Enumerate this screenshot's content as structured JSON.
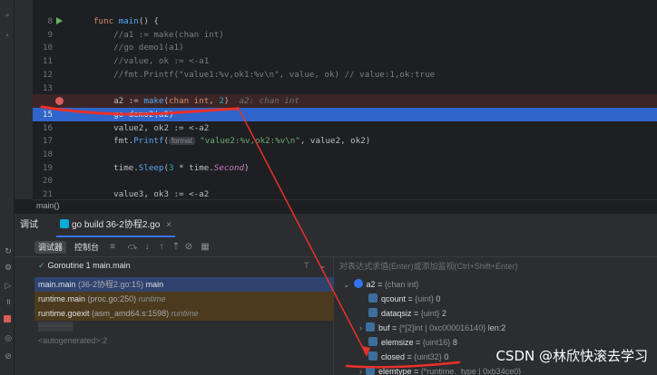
{
  "editor": {
    "lines": [
      {
        "num": "8",
        "parts": [
          [
            "kw",
            "func "
          ],
          [
            "fn",
            "main"
          ],
          [
            "",
            "() {"
          ]
        ]
      },
      {
        "num": "9",
        "parts": [
          [
            "cm",
            "    //a1 := make(chan int)"
          ]
        ]
      },
      {
        "num": "10",
        "parts": [
          [
            "cm",
            "    //go demo1(a1)"
          ]
        ]
      },
      {
        "num": "11",
        "parts": [
          [
            "cm",
            "    //value, ok := <-a1"
          ]
        ]
      },
      {
        "num": "12",
        "parts": [
          [
            "cm",
            "    //fmt.Printf(\"value1:%v,ok1:%v\\n\", value, ok) // value:1,ok:true"
          ]
        ]
      },
      {
        "num": "13",
        "parts": []
      },
      {
        "num": "",
        "parts": [
          [
            "",
            "    a2 := "
          ],
          [
            "fn",
            "make"
          ],
          [
            "",
            "("
          ],
          [
            "kw",
            "chan int"
          ],
          [
            "",
            ", "
          ],
          [
            "num",
            "2"
          ],
          [
            "",
            ")  "
          ],
          [
            "hint",
            "a2: chan int"
          ]
        ]
      },
      {
        "num": "15",
        "parts": [
          [
            "",
            "    go demo2(a2)"
          ]
        ]
      },
      {
        "num": "16",
        "parts": [
          [
            "",
            "    value2, ok2 := <-a2"
          ]
        ]
      },
      {
        "num": "17",
        "parts": [
          [
            "",
            "    fmt."
          ],
          [
            "fn",
            "Printf"
          ],
          [
            "",
            "("
          ],
          [
            "chip",
            "format"
          ],
          [
            "str",
            " \"value2:%v,ok2:%v\\n\""
          ],
          [
            "",
            ", value2, ok2)"
          ]
        ]
      },
      {
        "num": "18",
        "parts": []
      },
      {
        "num": "19",
        "parts": [
          [
            "",
            "    time."
          ],
          [
            "fn",
            "Sleep"
          ],
          [
            "",
            "("
          ],
          [
            "num",
            "3"
          ],
          [
            "",
            " * time."
          ],
          [
            "it",
            "Second"
          ],
          [
            "",
            ")"
          ]
        ]
      },
      {
        "num": "20",
        "parts": []
      },
      {
        "num": "21",
        "parts": [
          [
            "",
            "    value3, ok3 := <-a2"
          ]
        ]
      }
    ],
    "breadcrumb": "main()"
  },
  "debug": {
    "panel_label": "调试",
    "run_config": "go build 36-2协程2.go",
    "subtabs": {
      "debugger": "调试器",
      "console": "控制台"
    },
    "thread": "Goroutine 1 main.main",
    "frames": [
      {
        "name": "main.main",
        "loc": "(36-2协程2.go:15)",
        "extra": "main"
      },
      {
        "name": "runtime.main",
        "loc": "(proc.go:250)",
        "extra": "runtime"
      },
      {
        "name": "runtime.goexit",
        "loc": "(asm_amd64.s:1598)",
        "extra": "runtime"
      },
      {
        "name": "▒▒▒▒▒▒",
        "loc": "",
        "extra": ""
      },
      {
        "name": "<autogenerated>:2",
        "loc": "",
        "extra": ""
      }
    ],
    "vars_hint": "对表达式求值(Enter)或添加监视(Ctrl+Shift+Enter)",
    "variables": [
      {
        "name": "a2",
        "type": "{chan int}",
        "value": ""
      },
      {
        "name": "qcount",
        "type": "{uint}",
        "value": "0"
      },
      {
        "name": "dataqsiz",
        "type": "{uint}",
        "value": "2"
      },
      {
        "name": "buf",
        "type": "{*[2]int | 0xc000016140}",
        "value": "len:2"
      },
      {
        "name": "elemsize",
        "type": "{uint16}",
        "value": "8"
      },
      {
        "name": "closed",
        "type": "{uint32}",
        "value": "0"
      },
      {
        "name": "elemtype",
        "type": "{*runtime._type | 0xb34ce0}",
        "value": ""
      }
    ]
  },
  "watermark": "CSDN @林欣快滚去学习",
  "colors": {
    "annotation": "#e8312a",
    "exec_line": "#2f65ca",
    "breakpoint": "#db5c5c"
  }
}
